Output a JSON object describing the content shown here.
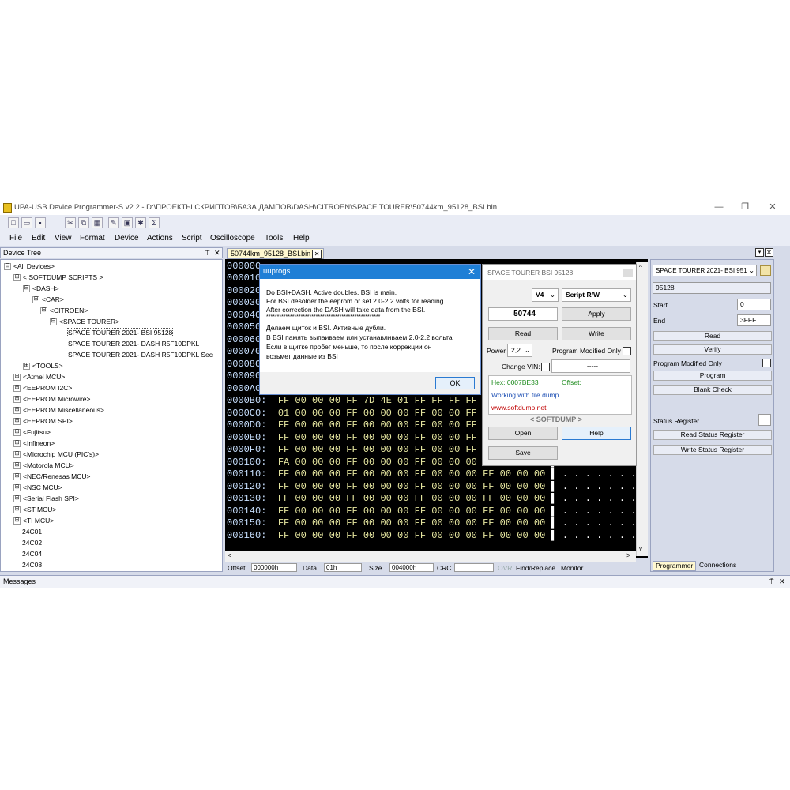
{
  "window": {
    "title": "UPA-USB Device Programmer-S v2.2 - D:\\ПРОЕКТЫ СКРИПТОВ\\БАЗА ДАМПОВ\\DASH\\CITROEN\\SPACE TOURER\\50744km_95128_BSI.bin",
    "minimize": "—",
    "maximize": "❐",
    "close": "✕"
  },
  "menu": [
    "File",
    "Edit",
    "View",
    "Format",
    "Device",
    "Actions",
    "Script",
    "Oscilloscope",
    "Tools",
    "Help"
  ],
  "device_tree": {
    "header": "Device Tree",
    "pin": "⍑",
    "close": "✕",
    "nodes": [
      {
        "label": "<All Devices>",
        "exp": "⊟"
      },
      {
        "label": "< SOFTDUMP SCRIPTS >",
        "exp": "⊟"
      },
      {
        "label": "<DASH>",
        "exp": "⊟"
      },
      {
        "label": "<CAR>",
        "exp": "⊟"
      },
      {
        "label": "<CITROEN>",
        "exp": "⊟"
      },
      {
        "label": "<SPACE TOURER>",
        "exp": "⊟"
      },
      {
        "label": "SPACE TOURER 2021- BSI 95128",
        "exp": ""
      },
      {
        "label": "SPACE TOURER 2021- DASH R5F10DPKL",
        "exp": ""
      },
      {
        "label": "SPACE TOURER 2021- DASH R5F10DPKL Sec",
        "exp": ""
      },
      {
        "label": "<TOOLS>",
        "exp": "⊞"
      },
      {
        "label": "<Atmel MCU>",
        "exp": "⊞"
      },
      {
        "label": "<EEPROM I2C>",
        "exp": "⊞"
      },
      {
        "label": "<EEPROM Microwire>",
        "exp": "⊞"
      },
      {
        "label": "<EEPROM Miscellaneous>",
        "exp": "⊞"
      },
      {
        "label": "<EEPROM SPI>",
        "exp": "⊞"
      },
      {
        "label": "<Fujitsu>",
        "exp": "⊞"
      },
      {
        "label": "<Infineon>",
        "exp": "⊞"
      },
      {
        "label": "<Microchip MCU (PIC's)>",
        "exp": "⊞"
      },
      {
        "label": "<Motorola MCU>",
        "exp": "⊞"
      },
      {
        "label": "<NEC/Renesas MCU>",
        "exp": "⊞"
      },
      {
        "label": "<NSC MCU>",
        "exp": "⊞"
      },
      {
        "label": "<Serial Flash SPI>",
        "exp": "⊞"
      },
      {
        "label": "<ST MCU>",
        "exp": "⊞"
      },
      {
        "label": "<TI MCU>",
        "exp": "⊞"
      },
      {
        "label": "24C01",
        "exp": ""
      },
      {
        "label": "24C02",
        "exp": ""
      },
      {
        "label": "24C04",
        "exp": ""
      },
      {
        "label": "24C08",
        "exp": ""
      }
    ]
  },
  "editor": {
    "tab_label": "50744km_95128_BSI.bin",
    "tab_close": "✕",
    "hidden_rows": [
      {
        "addr": "000000",
        "bytes": ""
      },
      {
        "addr": "000010",
        "bytes": ""
      },
      {
        "addr": "000020",
        "bytes": ""
      },
      {
        "addr": "000030",
        "bytes": ""
      },
      {
        "addr": "000040",
        "bytes": ""
      },
      {
        "addr": "000050",
        "bytes": ""
      },
      {
        "addr": "000060",
        "bytes": ""
      },
      {
        "addr": "000070",
        "bytes": ""
      },
      {
        "addr": "000080",
        "bytes": ""
      },
      {
        "addr": "000090",
        "bytes": ""
      },
      {
        "addr": "0000A0",
        "bytes": ""
      }
    ],
    "rows": [
      {
        "addr": "0000B0:",
        "bytes": "FF 00 00 00 FF 7D 4E 01 FF FF FF FF",
        "ascii": ""
      },
      {
        "addr": "0000C0:",
        "bytes": "01 00 00 00 FF 00 00 00 FF 00 00 FF",
        "ascii": ""
      },
      {
        "addr": "0000D0:",
        "bytes": "FF 00 00 00 FF 00 00 00 FF 00 00 FF",
        "ascii": ""
      },
      {
        "addr": "0000E0:",
        "bytes": "FF 00 00 00 FF 00 00 00 FF 00 00 FF",
        "ascii": ""
      },
      {
        "addr": "0000F0:",
        "bytes": "FF 00 00 00 FF 00 00 00 FF 00 00 FF",
        "ascii": ""
      },
      {
        "addr": "000100:",
        "bytes": "FA 00 00 00 FF 00 00 00 FF 00 00 00 FF 00 00 00",
        "ascii": "▌ . . . . . . . ."
      },
      {
        "addr": "000110:",
        "bytes": "FF 00 00 00 FF 00 00 00 FF 00 00 00 FF 00 00 00",
        "ascii": "▌ . . . . . . . ."
      },
      {
        "addr": "000120:",
        "bytes": "FF 00 00 00 FF 00 00 00 FF 00 00 00 FF 00 00 00",
        "ascii": "▌ . . . . . . . ."
      },
      {
        "addr": "000130:",
        "bytes": "FF 00 00 00 FF 00 00 00 FF 00 00 00 FF 00 00 00",
        "ascii": "▌ . . . . . . . ."
      },
      {
        "addr": "000140:",
        "bytes": "FF 00 00 00 FF 00 00 00 FF 00 00 00 FF 00 00 00",
        "ascii": "▌ . . . . . . . ."
      },
      {
        "addr": "000150:",
        "bytes": "FF 00 00 00 FF 00 00 00 FF 00 00 00 FF 00 00 00",
        "ascii": "▌ . . . . . . . ."
      },
      {
        "addr": "000160:",
        "bytes": "FF 00 00 00 FF 00 00 00 FF 00 00 00 FF 00 00 00",
        "ascii": "▌ . . . . . . . ."
      }
    ]
  },
  "statusbar": {
    "offset_label": "Offset",
    "offset_value": "000000h",
    "data_label": "Data",
    "data_value": "01h",
    "size_label": "Size",
    "size_value": "004000h",
    "crc_label": "CRC",
    "crc_value": "",
    "ovr": "OVR",
    "find_replace": "Find/Replace",
    "monitor": "Monitor"
  },
  "dialog": {
    "title": "uuprogs",
    "close": "✕",
    "lines": [
      "Do BSI+DASH. Active doubles. BSI is main.",
      "For BSI desolder the eeprom or set 2.0-2.2 volts for reading.",
      "After correction the DASH will take data from the BSI.",
      "*****************************************************",
      "Делаем щиток и BSI. Активные дубли.",
      "В BSI память выпаиваем или устанавливаем 2,0-2,2 вольта",
      "Если в щитке пробег меньше, то после коррекции он",
      "возьмет данные из BSI"
    ],
    "ok": "OK"
  },
  "script_panel": {
    "title": "SPACE TOURER BSI 95128",
    "version": "V4",
    "mode": "Script R/W",
    "mileage": "50744",
    "apply": "Apply",
    "read": "Read",
    "write": "Write",
    "power_label": "Power",
    "power_value": "2,2",
    "pmo_label": "Program Modified Only",
    "vin_label": "Change VIN:",
    "vin_value": "-----",
    "hex_text": "Hex: 0007BE33",
    "offset_text": "Offset:",
    "working_text": "Working with file dump",
    "site_text": "www.softdump.net",
    "brand": "< SOFTDUMP >",
    "open": "Open",
    "help": "Help",
    "save": "Save"
  },
  "right_panel": {
    "device_select": "SPACE TOURER 2021- BSI 951",
    "device_name": "95128",
    "start_label": "Start",
    "start_value": "0",
    "end_label": "End",
    "end_value": "3FFF",
    "read": "Read",
    "verify": "Verify",
    "pmo_label": "Program Modified Only",
    "program": "Program",
    "blank_check": "Blank Check",
    "status_register": "Status Register",
    "read_status": "Read Status Register",
    "write_status": "Write Status Register",
    "tab_programmer": "Programmer",
    "tab_connections": "Connections"
  },
  "messages": {
    "label": "Messages",
    "pin": "⍑",
    "close": "✕"
  },
  "colors": {
    "accent": "#1f7fd6",
    "hex_bg": "#000000",
    "hex_bytes": "#e6e6a0",
    "hex_addr": "#c8e0ff",
    "link_red": "#c00000",
    "link_blue": "#1e50b4",
    "hex_green": "#1c8a1c"
  }
}
